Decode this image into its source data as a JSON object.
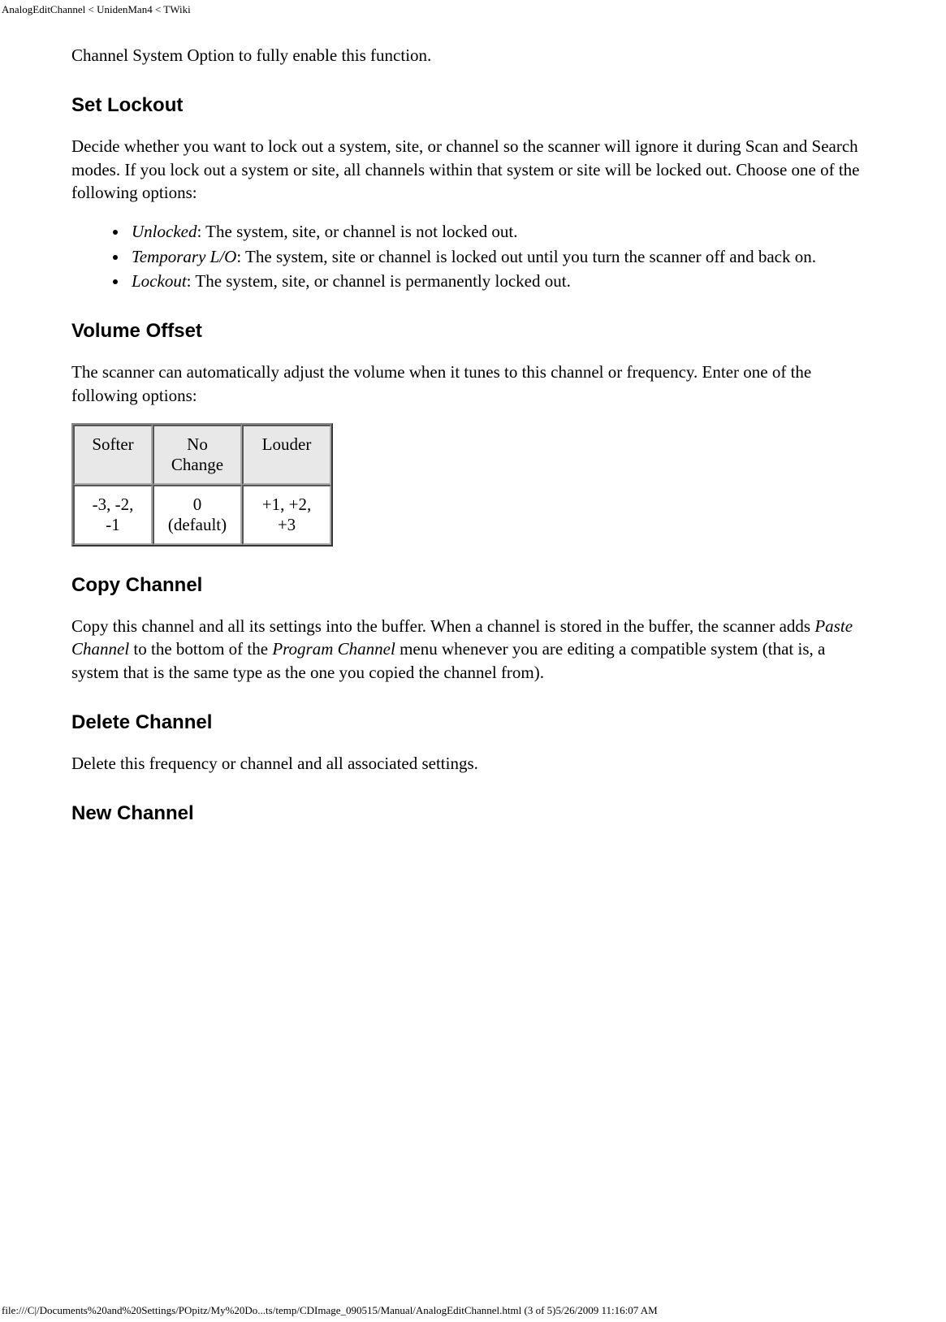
{
  "header_path": "AnalogEditChannel < UnidenMan4 < TWiki",
  "intro_line": "Channel System Option to fully enable this function.",
  "sections": {
    "set_lockout": {
      "heading": "Set Lockout",
      "para": "Decide whether you want to lock out a system, site, or channel so the scanner will ignore it during Scan and Search modes. If you lock out a system or site, all channels within that system or site will be locked out. Choose one of the following options:",
      "items": [
        {
          "term": "Unlocked",
          "desc": ": The system, site, or channel is not locked out."
        },
        {
          "term": "Temporary L/O",
          "desc": ": The system, site or channel is locked out until you turn the scanner off and back on."
        },
        {
          "term": "Lockout",
          "desc": ": The system, site, or channel is permanently locked out."
        }
      ]
    },
    "volume_offset": {
      "heading": "Volume Offset",
      "para": "The scanner can automatically adjust the volume when it tunes to this channel or frequency. Enter one of the following options:",
      "table": {
        "headers": [
          "Softer",
          "No Change",
          "Louder"
        ],
        "row": [
          "-3, -2, -1",
          "0 (default)",
          "+1, +2, +3"
        ]
      }
    },
    "copy_channel": {
      "heading": "Copy Channel",
      "para_pre": "Copy this channel and all its settings into the buffer. When a channel is stored in the buffer, the scanner adds ",
      "em1": "Paste Channel",
      "mid": " to the bottom of the ",
      "em2": "Program Channel",
      "para_post": " menu whenever you are editing a compatible system (that is, a system that is the same type as the one you copied the channel from)."
    },
    "delete_channel": {
      "heading": "Delete Channel",
      "para": "Delete this frequency or channel and all associated settings."
    },
    "new_channel": {
      "heading": "New Channel"
    }
  },
  "footer": "file:///C|/Documents%20and%20Settings/POpitz/My%20Do...ts/temp/CDImage_090515/Manual/AnalogEditChannel.html (3 of 5)5/26/2009 11:16:07 AM"
}
